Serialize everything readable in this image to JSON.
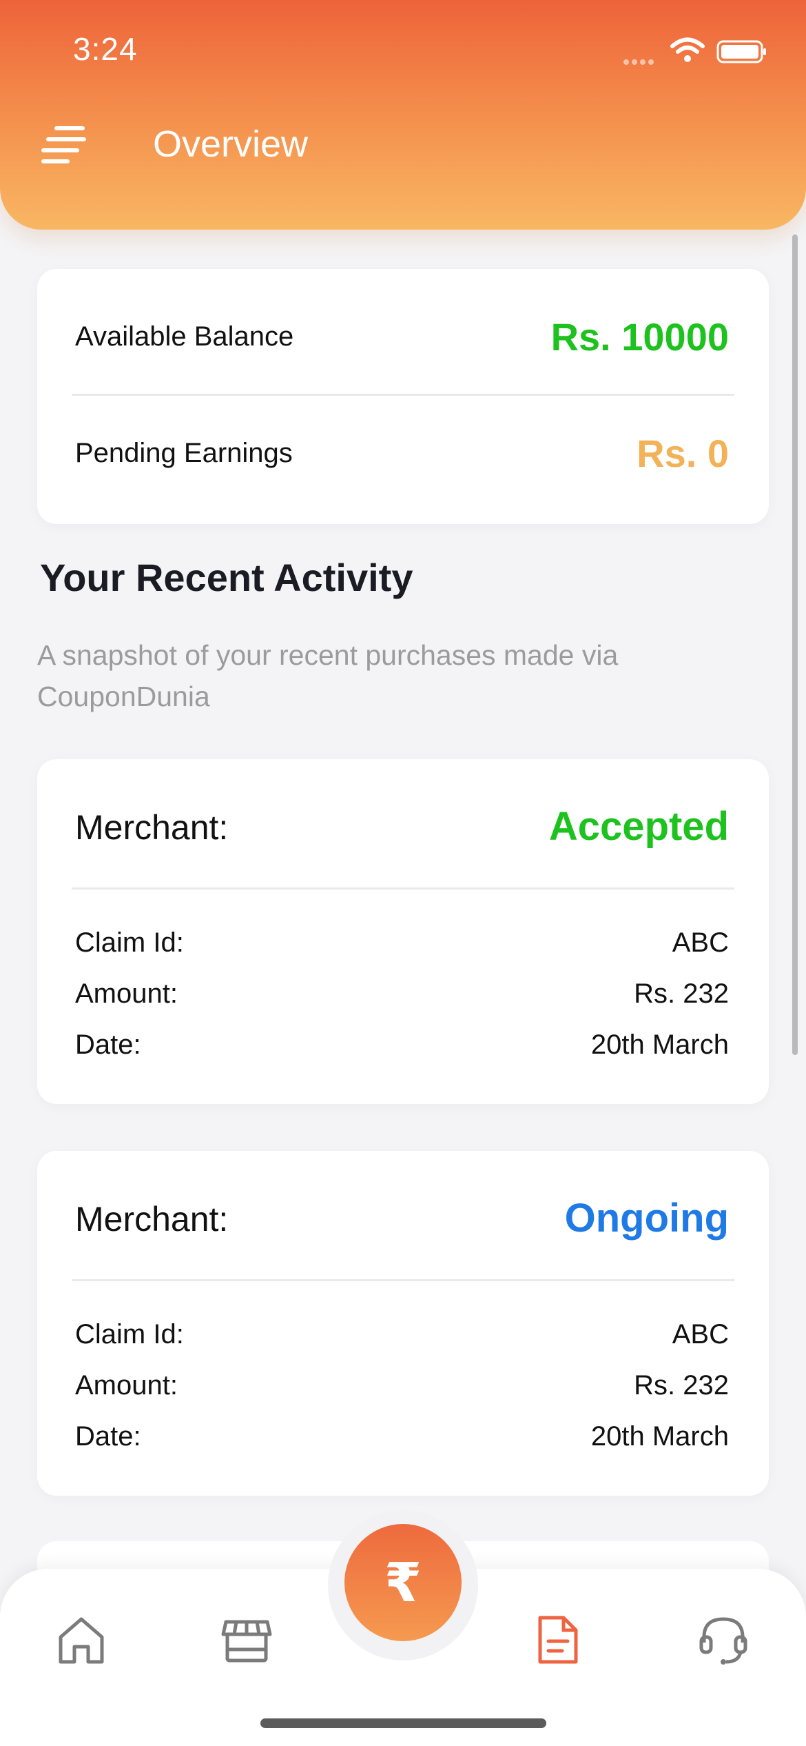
{
  "status_bar": {
    "time": "3:24"
  },
  "header": {
    "title": "Overview",
    "menu_icon": "menu-icon"
  },
  "balance": {
    "available_label": "Available Balance",
    "available_value": "Rs. 10000",
    "pending_label": "Pending Earnings",
    "pending_value": "Rs. 0"
  },
  "activity": {
    "title": "Your Recent Activity",
    "subtitle": "A snapshot of your recent purchases made via CouponDunia",
    "items": [
      {
        "merchant_label": "Merchant:",
        "status": "Accepted",
        "claim_label": "Claim Id:",
        "claim_value": "ABC",
        "amount_label": "Amount:",
        "amount_value": "Rs. 232",
        "date_label": "Date:",
        "date_value": "20th March"
      },
      {
        "merchant_label": "Merchant:",
        "status": "Ongoing",
        "claim_label": "Claim Id:",
        "claim_value": "ABC",
        "amount_label": "Amount:",
        "amount_value": "Rs. 232",
        "date_label": "Date:",
        "date_value": "20th March"
      }
    ]
  },
  "tabbar": {
    "fab_symbol": "₹",
    "tabs": [
      "home-icon",
      "store-icon",
      "document-icon",
      "support-icon"
    ]
  },
  "colors": {
    "brand_orange": "#ee633a",
    "accepted_green": "#1ec21e",
    "pending_orange": "#f2b258",
    "ongoing_blue": "#1f7ae6",
    "active_tab": "#ee6340",
    "inactive_tab": "#7b7b7b"
  }
}
